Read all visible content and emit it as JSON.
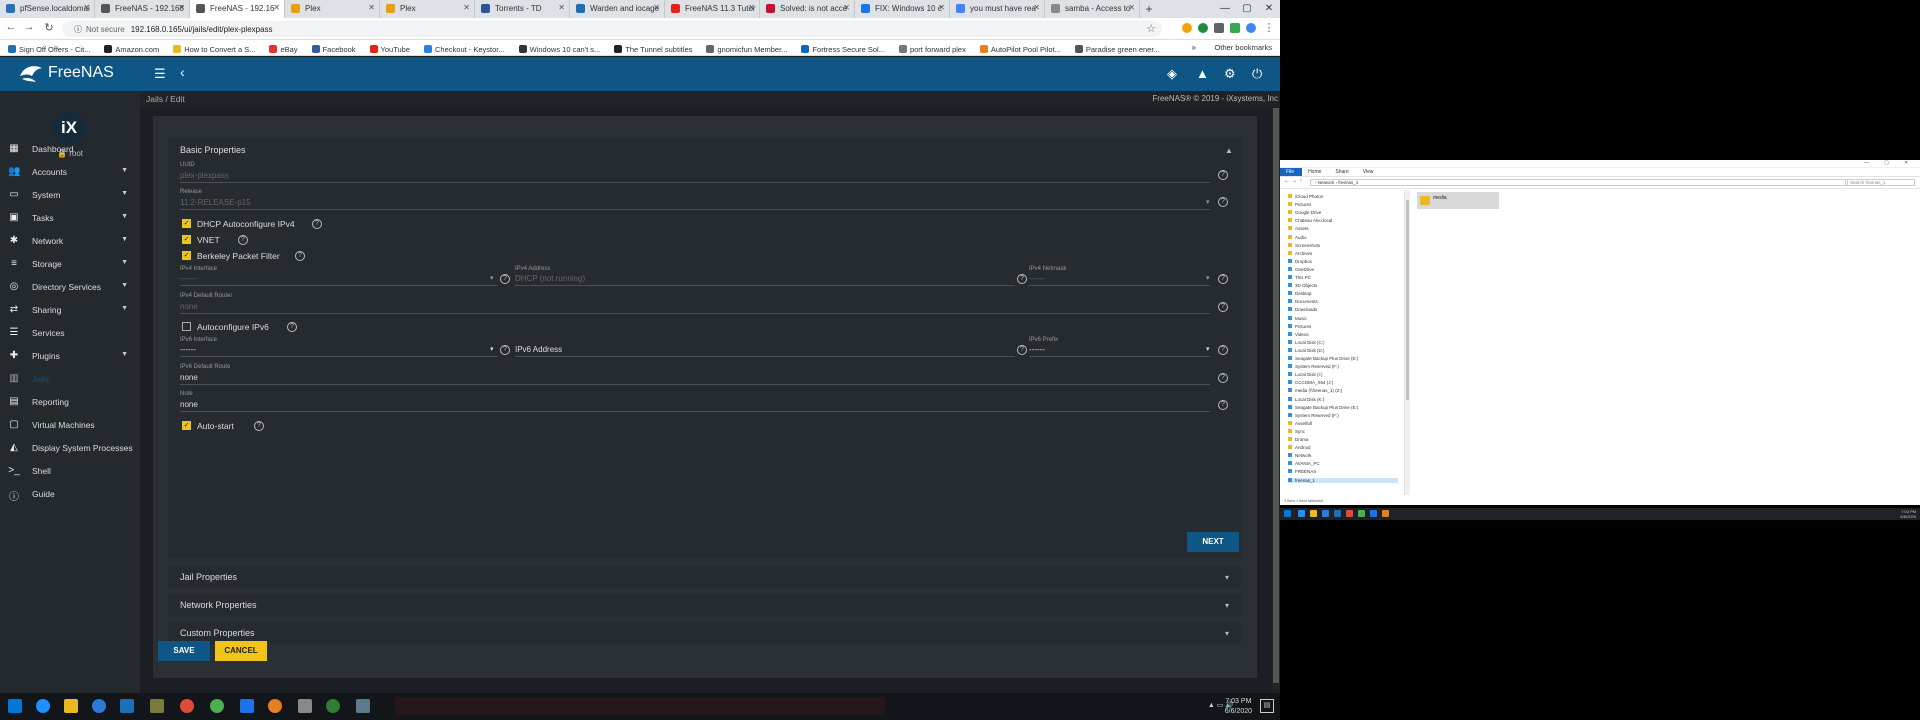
{
  "browser": {
    "tabs": [
      {
        "label": "pfSense.localdomai",
        "color": "#2c6fb6",
        "active": false
      },
      {
        "label": "FreeNAS - 192.168",
        "color": "#555555",
        "active": false
      },
      {
        "label": "FreeNAS - 192.16",
        "color": "#555555",
        "active": true
      },
      {
        "label": "Plex",
        "color": "#e5a00d",
        "active": false
      },
      {
        "label": "Plex",
        "color": "#e5a00d",
        "active": false
      },
      {
        "label": "Torrents - TD",
        "color": "#2b5797",
        "active": false
      },
      {
        "label": "Warden and iocage",
        "color": "#1f6fb5",
        "active": false
      },
      {
        "label": "FreeNAS 11.3 Tutor",
        "color": "#e62117",
        "active": false
      },
      {
        "label": "Solved: is not acce",
        "color": "#c8102e",
        "active": false
      },
      {
        "label": "FIX: Windows 10 c",
        "color": "#1a73e8",
        "active": false
      },
      {
        "label": "you must have rea",
        "color": "#4285f4",
        "active": false
      },
      {
        "label": "samba - Access to",
        "color": "#888888",
        "active": false
      }
    ],
    "newtab": "+",
    "url_status": "Not secure",
    "url": "192.168.0.165/ui/jails/edit/plex-plexpass",
    "bookmarks": [
      {
        "label": "Sign Off Offers - Cit...",
        "color": "#1d6fb8"
      },
      {
        "label": "Amazon.com",
        "color": "#222222"
      },
      {
        "label": "How to Convert a S...",
        "color": "#e8b923"
      },
      {
        "label": "eBay",
        "color": "#e53238"
      },
      {
        "label": "Facebook",
        "color": "#3b5998"
      },
      {
        "label": "YouTube",
        "color": "#e62117"
      },
      {
        "label": "Checkout - Keystor...",
        "color": "#2a82da"
      },
      {
        "label": "Windows 10 can't s...",
        "color": "#333333"
      },
      {
        "label": "The Tunnel subtitles",
        "color": "#222222"
      },
      {
        "label": "gnomicfun Member...",
        "color": "#666666"
      },
      {
        "label": "Fortress Secure Sol...",
        "color": "#1565c0"
      },
      {
        "label": "port forward plex",
        "color": "#777777"
      },
      {
        "label": "AutoPilot Pool Pilot...",
        "color": "#e67e22"
      },
      {
        "label": "Paradise green ener...",
        "color": "#555555"
      }
    ],
    "bookmarks_more": "»",
    "other_bookmarks": "Other bookmarks"
  },
  "app": {
    "logo_text": "FreeNAS",
    "breadcrumb": "Jails  /  Edit",
    "copyright": "FreeNAS® © 2019 - iXsystems, Inc",
    "avatar": "iX",
    "user": "root",
    "accent": "#0d5685",
    "warn": "#f0c419"
  },
  "sidebar": [
    {
      "label": "Dashboard",
      "icon": "▦",
      "caret": false,
      "active": false
    },
    {
      "label": "Accounts",
      "icon": "👥",
      "caret": true,
      "active": false
    },
    {
      "label": "System",
      "icon": "▭",
      "caret": true,
      "active": false
    },
    {
      "label": "Tasks",
      "icon": "▣",
      "caret": true,
      "active": false
    },
    {
      "label": "Network",
      "icon": "✱",
      "caret": true,
      "active": false
    },
    {
      "label": "Storage",
      "icon": "≡",
      "caret": true,
      "active": false
    },
    {
      "label": "Directory Services",
      "icon": "◎",
      "caret": true,
      "active": false
    },
    {
      "label": "Sharing",
      "icon": "⇄",
      "caret": true,
      "active": false
    },
    {
      "label": "Services",
      "icon": "☰",
      "caret": false,
      "active": false
    },
    {
      "label": "Plugins",
      "icon": "✚",
      "caret": true,
      "active": false
    },
    {
      "label": "Jails",
      "icon": "▥",
      "caret": false,
      "active": true
    },
    {
      "label": "Reporting",
      "icon": "▤",
      "caret": false,
      "active": false
    },
    {
      "label": "Virtual Machines",
      "icon": "▢",
      "caret": false,
      "active": false
    },
    {
      "label": "Display System Processes",
      "icon": "◭",
      "caret": false,
      "active": false
    },
    {
      "label": "Shell",
      "icon": ">_",
      "caret": false,
      "active": false
    },
    {
      "label": "Guide",
      "icon": "ⓘ",
      "caret": false,
      "active": false
    }
  ],
  "form": {
    "basic_title": "Basic Properties",
    "uuid_label": "UUID",
    "uuid_value": "plex-plexpass",
    "release_label": "Release",
    "release_value": "11.2-RELEASE-p15",
    "dhcp_label": "DHCP Autoconfigure IPv4",
    "vnet_label": "VNET",
    "bpf_label": "Berkeley Packet Filter",
    "ipv4_iface_label": "IPv4 Interface",
    "ipv4_iface_value": "------",
    "ipv4_addr_label": "IPv4 Address",
    "ipv4_addr_value": "DHCP (not running)",
    "ipv4_mask_label": "IPv4 Netmask",
    "ipv4_mask_value": "------",
    "ipv4_router_label": "IPv4 Default Router",
    "ipv4_router_value": "none",
    "autoipv6_label": "Autoconfigure IPv6",
    "ipv6_iface_label": "IPv6 Interface",
    "ipv6_iface_value": "------",
    "ipv6_addr_value": "IPv6 Address",
    "ipv6_prefix_label": "IPv6 Prefix",
    "ipv6_prefix_value": "------",
    "ipv6_route_label": "IPv6 Default Route",
    "ipv6_route_value": "none",
    "note_label": "Note",
    "note_value": "none",
    "autostart_label": "Auto-start",
    "next_label": "NEXT",
    "jail_props": "Jail Properties",
    "network_props": "Network Properties",
    "custom_props": "Custom Properties",
    "save_label": "SAVE",
    "cancel_label": "CANCEL"
  },
  "taskbar": {
    "time": "7:03 PM",
    "date": "6/6/2020"
  },
  "explorer": {
    "ribbon": [
      "File",
      "Home",
      "Share",
      "View"
    ],
    "path": "›  Network  ›  freenas_1",
    "search": "Search freenas_1",
    "nav": [
      {
        "label": "iCloud Photos",
        "pc": false
      },
      {
        "label": "Pictures",
        "pc": false
      },
      {
        "label": "Google Drive",
        "pc": false
      },
      {
        "label": "Chateau Alvo.local",
        "pc": false
      },
      {
        "label": "Assets",
        "pc": false
      },
      {
        "label": "Audio",
        "pc": false
      },
      {
        "label": "Screenshots",
        "pc": false
      },
      {
        "label": "Archives",
        "pc": false
      },
      {
        "label": "Dropbox",
        "pc": true
      },
      {
        "label": "OneDrive",
        "pc": true
      },
      {
        "label": "This PC",
        "pc": true
      },
      {
        "label": "3D Objects",
        "pc": true
      },
      {
        "label": "Desktop",
        "pc": true
      },
      {
        "label": "Documents",
        "pc": true
      },
      {
        "label": "Downloads",
        "pc": true
      },
      {
        "label": "Music",
        "pc": true
      },
      {
        "label": "Pictures",
        "pc": true
      },
      {
        "label": "Videos",
        "pc": true
      },
      {
        "label": "Local Disk (C:)",
        "pc": true
      },
      {
        "label": "Local Disk (D:)",
        "pc": true
      },
      {
        "label": "Seagate Backup Plus Drive (E:)",
        "pc": true
      },
      {
        "label": "System Reserved (F:)",
        "pc": true
      },
      {
        "label": "Local Disk (I:)",
        "pc": true
      },
      {
        "label": "CCCOMA_X64 (J:)",
        "pc": true
      },
      {
        "label": "media (\\\\freenas_1) (Z:)",
        "pc": true
      },
      {
        "label": "Local Disk (K:)",
        "pc": true
      },
      {
        "label": "Seagate Backup Plus Drive (E:)",
        "pc": true
      },
      {
        "label": "System Reserved (F:)",
        "pc": true
      },
      {
        "label": "Assetfull",
        "pc": false
      },
      {
        "label": "Sync",
        "pc": false
      },
      {
        "label": "Drama",
        "pc": false
      },
      {
        "label": "Android",
        "pc": false
      },
      {
        "label": "Network",
        "pc": true
      },
      {
        "label": "AVANIA_PC",
        "pc": true
      },
      {
        "label": "FREENAS",
        "pc": true
      },
      {
        "label": "freenas_1",
        "pc": true
      }
    ],
    "folder": "media",
    "status": "1 item    1 item selected",
    "time": "7:03 PM",
    "date": "6/6/2020"
  }
}
